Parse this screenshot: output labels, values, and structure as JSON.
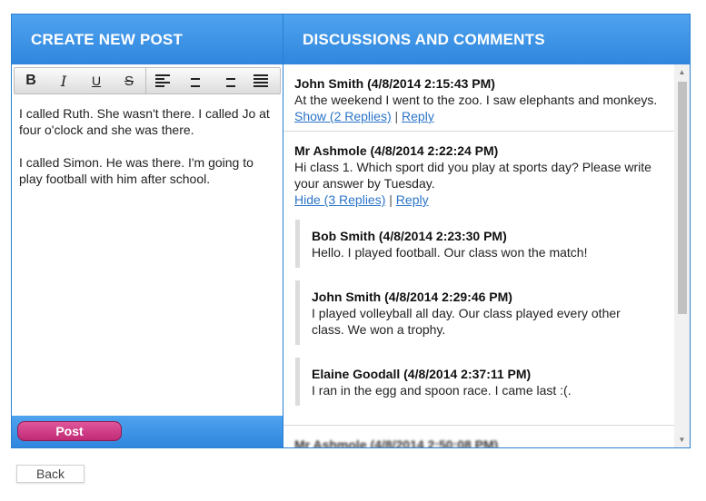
{
  "create_panel": {
    "title": "CREATE NEW POST",
    "toolbar": {
      "bold": "B",
      "italic": "I",
      "underline": "U",
      "strikethrough": "S"
    },
    "editor_paragraphs": [
      "I called Ruth. She wasn't there. I called Jo at four o'clock and she was there.",
      "I called Simon. He was there. I'm going to play football with him after school."
    ],
    "post_label": "Post"
  },
  "discussion_panel": {
    "title": "DISCUSSIONS AND COMMENTS",
    "reply_link": "Reply",
    "separator": "|",
    "comments": [
      {
        "author": "John Smith (4/8/2014 2:15:43 PM)",
        "text": "At the weekend I went to the zoo. I saw elephants and monkeys.",
        "toggle": "Show (2 Replies)"
      },
      {
        "author": "Mr Ashmole (4/8/2014 2:22:24 PM)",
        "text": "Hi class 1. Which sport did you play at sports day? Please write your answer by Tuesday.",
        "toggle": "Hide (3 Replies)",
        "replies": [
          {
            "author": "Bob Smith (4/8/2014 2:23:30 PM)",
            "text": "Hello. I played football. Our class won the match!"
          },
          {
            "author": "John Smith (4/8/2014 2:29:46 PM)",
            "text": "I played volleyball all day. Our class played every other class. We won a trophy."
          },
          {
            "author": "Elaine Goodall (4/8/2014 2:37:11 PM)",
            "text": "I ran in the egg and spoon race. I came last :(."
          }
        ]
      },
      {
        "author": "Mr Ashmole (4/8/2014 2:50:08 PM)"
      }
    ]
  },
  "back_label": "Back"
}
